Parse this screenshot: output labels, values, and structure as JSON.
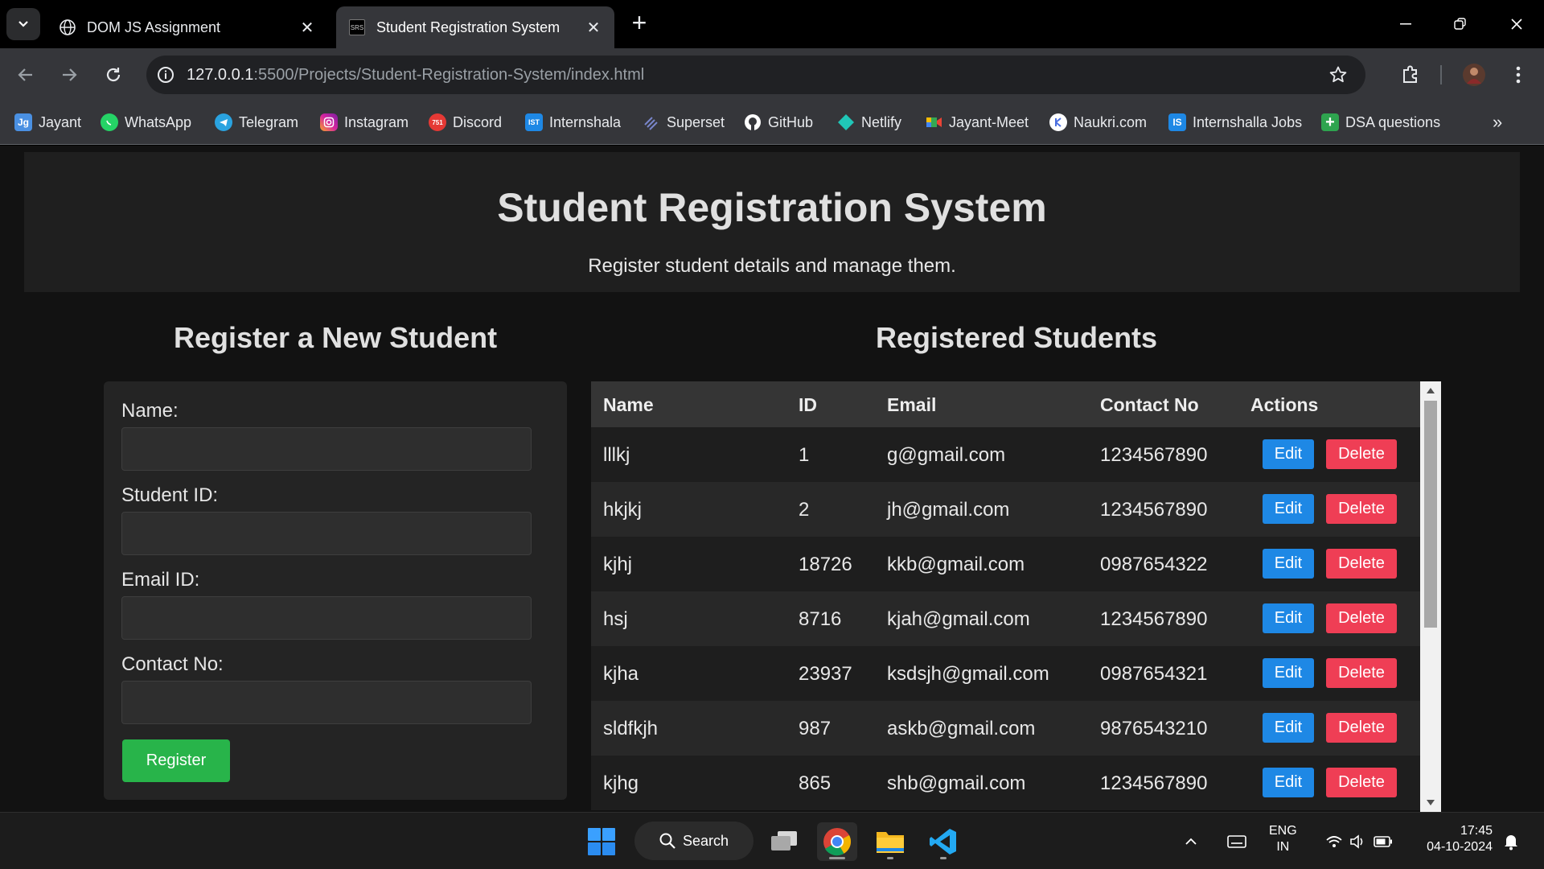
{
  "browser": {
    "tabs": [
      {
        "title": "DOM JS Assignment",
        "active": false,
        "icon": "globe-icon"
      },
      {
        "title": "Student Registration System",
        "active": true,
        "icon": "srs-favicon",
        "favicon_text": "SRS"
      }
    ],
    "url_host": "127.0.0.1",
    "url_rest": ":5500/Projects/Student-Registration-System/index.html",
    "bookmarks": [
      {
        "label": "Jayant",
        "icon": "jg-icon",
        "icon_text": "Jg",
        "color": "#4a90e2"
      },
      {
        "label": "WhatsApp",
        "icon": "whatsapp-icon",
        "color": "#25d366"
      },
      {
        "label": "Telegram",
        "icon": "telegram-icon",
        "color": "#2aa3e0"
      },
      {
        "label": "Instagram",
        "icon": "instagram-icon",
        "color": "#d6249f"
      },
      {
        "label": "Discord",
        "icon": "discord-icon",
        "icon_text": "751",
        "color": "#e53935"
      },
      {
        "label": "Internshala",
        "icon": "internshala-icon",
        "icon_text": "IST",
        "color": "#1e88e5"
      },
      {
        "label": "Superset",
        "icon": "superset-icon",
        "color": "#5c6bc0"
      },
      {
        "label": "GitHub",
        "icon": "github-icon",
        "color": "#ffffff"
      },
      {
        "label": "Netlify",
        "icon": "netlify-icon",
        "color": "#20c6b7"
      },
      {
        "label": "Jayant-Meet",
        "icon": "meet-icon",
        "color": "#34a853"
      },
      {
        "label": "Naukri.com",
        "icon": "naukri-icon",
        "color": "#4a6ee0"
      },
      {
        "label": "Internshalla Jobs",
        "icon": "internshala-jobs-icon",
        "icon_text": "IS",
        "color": "#1e88e5"
      },
      {
        "label": "DSA questions",
        "icon": "dsa-icon",
        "icon_text": "+",
        "color": "#2ea44f"
      }
    ]
  },
  "page": {
    "title": "Student Registration System",
    "subtitle": "Register student details and manage them.",
    "form_title": "Register a New Student",
    "list_title": "Registered Students",
    "form": {
      "name_label": "Name:",
      "id_label": "Student ID:",
      "email_label": "Email ID:",
      "contact_label": "Contact No:",
      "submit_label": "Register"
    },
    "table": {
      "headers": [
        "Name",
        "ID",
        "Email",
        "Contact No",
        "Actions"
      ],
      "rows": [
        {
          "name": "lllkj",
          "id": "1",
          "email": "g@gmail.com",
          "contact": "1234567890"
        },
        {
          "name": "hkjkj",
          "id": "2",
          "email": "jh@gmail.com",
          "contact": "1234567890"
        },
        {
          "name": "kjhj",
          "id": "18726",
          "email": "kkb@gmail.com",
          "contact": "0987654322"
        },
        {
          "name": "hsj",
          "id": "8716",
          "email": "kjah@gmail.com",
          "contact": "1234567890"
        },
        {
          "name": "kjha",
          "id": "23937",
          "email": "ksdsjh@gmail.com",
          "contact": "0987654321"
        },
        {
          "name": "sldfkjh",
          "id": "987",
          "email": "askb@gmail.com",
          "contact": "9876543210"
        },
        {
          "name": "kjhg",
          "id": "865",
          "email": "shb@gmail.com",
          "contact": "1234567890"
        }
      ],
      "edit_label": "Edit",
      "delete_label": "Delete"
    }
  },
  "taskbar": {
    "search_label": "Search",
    "lang_top": "ENG",
    "lang_bottom": "IN",
    "time": "17:45",
    "date": "04-10-2024"
  },
  "colors": {
    "register": "#28b44a",
    "edit": "#1e88e5",
    "delete": "#ef3e55"
  }
}
